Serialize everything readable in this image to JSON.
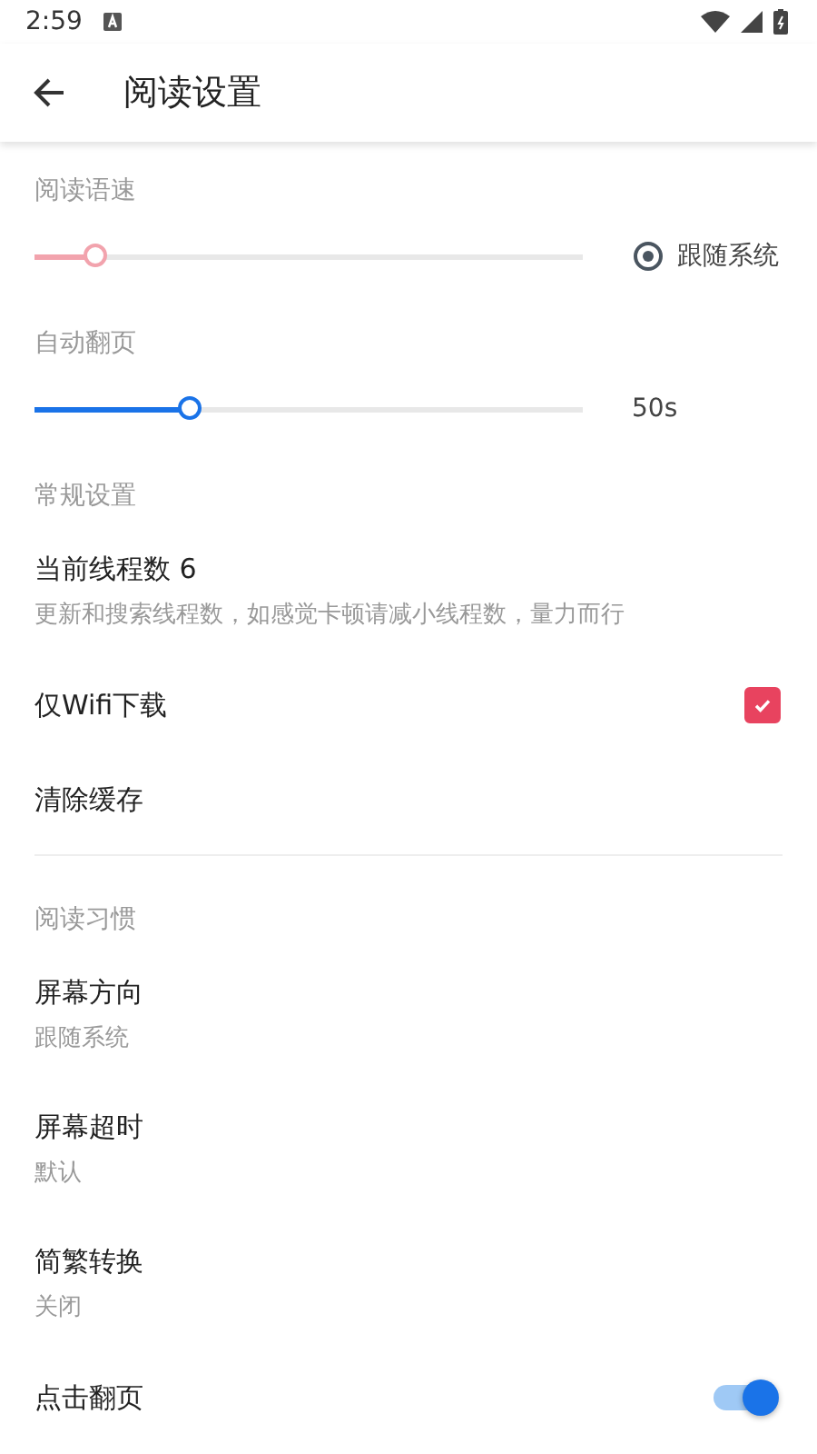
{
  "status_bar": {
    "time": "2:59"
  },
  "app_bar": {
    "title": "阅读设置"
  },
  "reading_speed": {
    "label": "阅读语速",
    "level": 0.11,
    "follow_system": {
      "label": "跟随系统",
      "selected": true
    }
  },
  "auto_page": {
    "label": "自动翻页",
    "level": 0.28,
    "reading": "50s"
  },
  "general": {
    "header": "常规设置",
    "items": [
      {
        "kind": "text",
        "title": "当前线程数 6",
        "subtitle": "更新和搜索线程数，如感觉卡顿请减小线程数，量力而行"
      },
      {
        "kind": "checkbox",
        "title": "仅Wifi下载",
        "checked": true
      },
      {
        "kind": "text",
        "title": "清除缓存"
      }
    ]
  },
  "habits": {
    "header": "阅读习惯",
    "items": [
      {
        "kind": "text",
        "title": "屏幕方向",
        "subtitle": "跟随系统"
      },
      {
        "kind": "text",
        "title": "屏幕超时",
        "subtitle": "默认"
      },
      {
        "kind": "text",
        "title": "简繁转换",
        "subtitle": "关闭"
      },
      {
        "kind": "switch",
        "title": "点击翻页",
        "on": true
      }
    ]
  }
}
